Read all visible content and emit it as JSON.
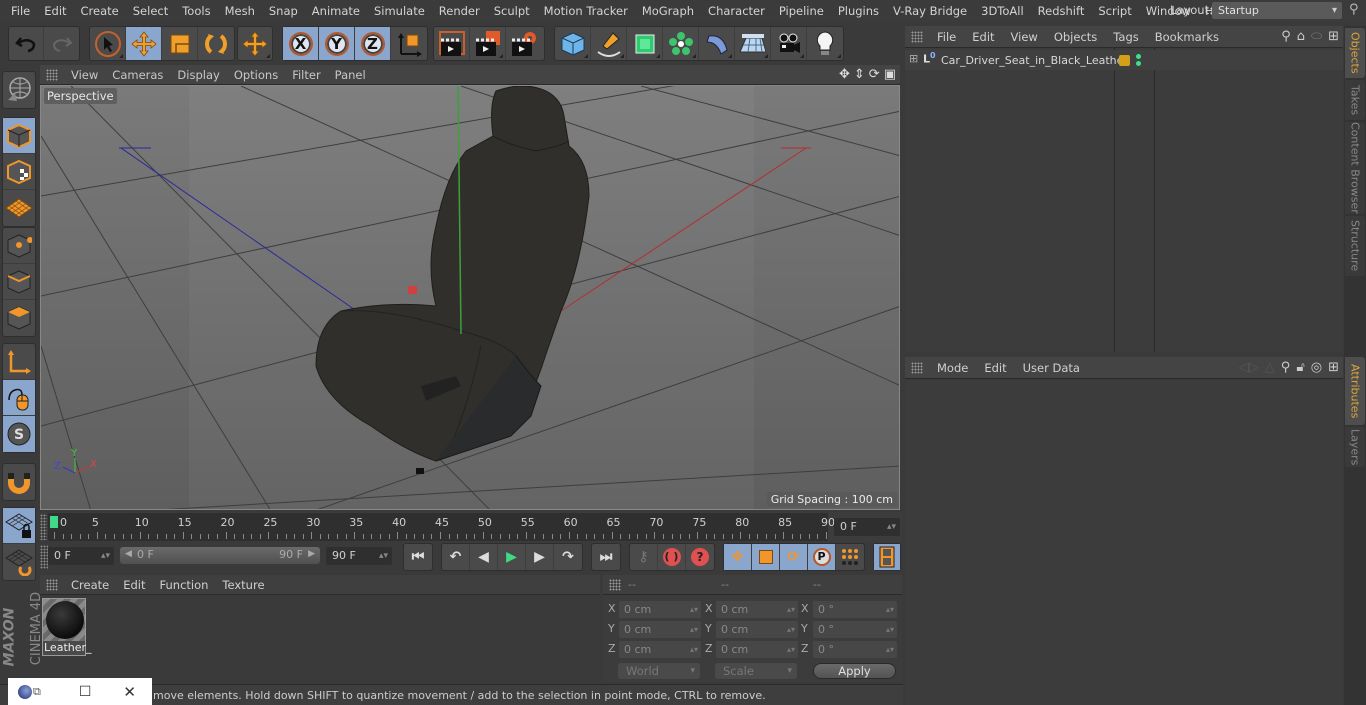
{
  "menubar": {
    "items": [
      "File",
      "Edit",
      "Create",
      "Select",
      "Tools",
      "Mesh",
      "Snap",
      "Animate",
      "Simulate",
      "Render",
      "Sculpt",
      "Motion Tracker",
      "MoGraph",
      "Character",
      "Pipeline",
      "Plugins",
      "V-Ray Bridge",
      "3DToAll",
      "Redshift",
      "Script",
      "Window",
      "Help"
    ],
    "layout_label": "Layout:",
    "layout_value": "Startup"
  },
  "toolbar": {
    "undo": "undo-icon",
    "redo": "redo-icon",
    "axis_x": "X",
    "axis_y": "Y",
    "axis_z": "Z"
  },
  "viewport": {
    "menu": [
      "View",
      "Cameras",
      "Display",
      "Options",
      "Filter",
      "Panel"
    ],
    "camera_label": "Perspective",
    "grid_spacing": "Grid Spacing : 100 cm",
    "axis_labels": {
      "x": "X",
      "y": "Y",
      "z": "Z"
    }
  },
  "timeline": {
    "ticks": [
      "0",
      "5",
      "10",
      "15",
      "20",
      "25",
      "30",
      "35",
      "40",
      "45",
      "50",
      "55",
      "60",
      "65",
      "70",
      "75",
      "80",
      "85",
      "90"
    ],
    "current_frame": "0 F",
    "start_field": "0 F",
    "range_start": "0 F",
    "range_end": "90 F",
    "end_field": "90 F"
  },
  "material_manager": {
    "menu": [
      "Create",
      "Edit",
      "Function",
      "Texture"
    ],
    "materials": [
      {
        "name": "Leather_"
      }
    ]
  },
  "coordinates": {
    "headers": [
      "--",
      "--",
      "--"
    ],
    "rows": [
      {
        "axis": "X",
        "pos": "0 cm",
        "size": "0 cm",
        "rot": "0 °"
      },
      {
        "axis": "Y",
        "pos": "0 cm",
        "size": "0 cm",
        "rot": "0 °"
      },
      {
        "axis": "Z",
        "pos": "0 cm",
        "size": "0 cm",
        "rot": "0 °"
      }
    ],
    "mode_select": "World",
    "scale_select": "Scale",
    "apply_label": "Apply"
  },
  "object_manager": {
    "menu": [
      "File",
      "Edit",
      "View",
      "Objects",
      "Tags",
      "Bookmarks"
    ],
    "objects": [
      {
        "name": "Car_Driver_Seat_in_Black_Leather",
        "layer_color": "#d4a017"
      }
    ]
  },
  "attributes": {
    "menu": [
      "Mode",
      "Edit",
      "User Data"
    ]
  },
  "side_tabs": {
    "top": [
      "Objects",
      "Takes",
      "Content Browser",
      "Structure"
    ],
    "bottom": [
      "Attributes",
      "Layers"
    ]
  },
  "status": {
    "text": "move elements. Hold down SHIFT to quantize movement / add to the selection in point mode, CTRL to remove."
  },
  "branding": {
    "maxon": "MAXON",
    "product": "CINEMA 4D"
  },
  "colors": {
    "accent_orange": "#f0962a",
    "active_blue": "#8ba6cc",
    "timeline_cursor": "#42d88a"
  }
}
